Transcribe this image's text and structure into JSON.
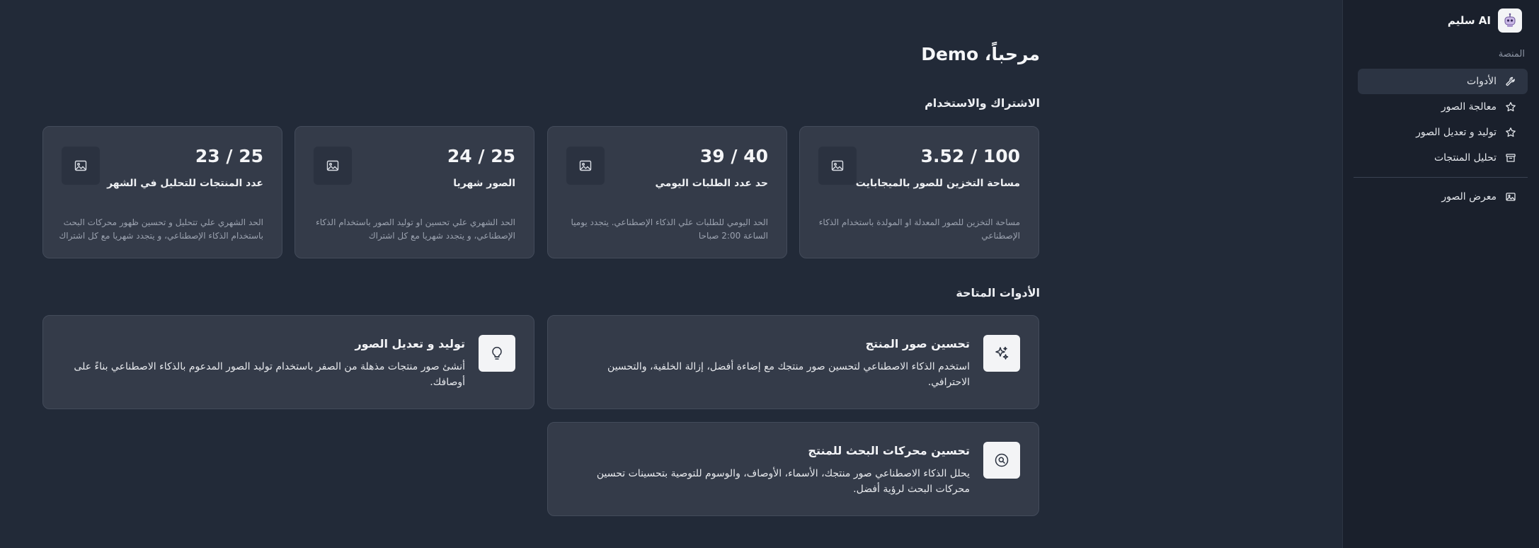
{
  "sidebar": {
    "brand_name": "سليم AI",
    "section_label": "المنصة",
    "items": [
      {
        "label": "الأدوات",
        "icon": "wrench-icon",
        "active": true
      },
      {
        "label": "معالجة الصور",
        "icon": "star-icon"
      },
      {
        "label": "توليد و تعديل الصور",
        "icon": "star-icon"
      },
      {
        "label": "تحليل المنتجات",
        "icon": "archive-icon"
      }
    ],
    "gallery": {
      "label": "معرض الصور",
      "icon": "image-icon"
    }
  },
  "main": {
    "welcome": "مرحباً، Demo",
    "usage_heading": "الاشتراك والاستخدام",
    "stats": [
      {
        "value": "3.52 / 100",
        "title": "مساحة التخزين للصور بالميجابايت",
        "desc": "مساحة التخزين للصور المعدلة او المولدة باستخدام الذكاء الإصطناعي"
      },
      {
        "value": "39 / 40",
        "title": "حد عدد الطلبات اليومي",
        "desc": "الحد اليومي للطلبات علي الذكاء الإصطناعي. يتجدد يوميا الساعة 2:00 صباحا"
      },
      {
        "value": "24 / 25",
        "title": "الصور شهريا",
        "desc": "الحد الشهري علي تحسين او توليد الصور باستخدام الذكاء الإصطناعي، و يتجدد شهريا مع كل اشتراك"
      },
      {
        "value": "23 / 25",
        "title": "عدد المنتجات للتحليل في الشهر",
        "desc": "الحد الشهري علي تتحليل و تحسين ظهور محركات البحث باستخدام الذكاء الإصطناعي، و يتجدد شهريا مع كل اشتراك"
      }
    ],
    "tools_heading": "الأدوات المتاحة",
    "tools": [
      {
        "title": "تحسين صور المنتج",
        "desc": "استخدم الذكاء الاصطناعي لتحسين صور منتجك مع إضاءة أفضل، إزالة الخلفية، والتحسين الاحترافي.",
        "icon": "sparkles-icon"
      },
      {
        "title": "توليد و تعديل الصور",
        "desc": "أنشئ صور منتجات مذهلة من الصفر باستخدام توليد الصور المدعوم بالذكاء الاصطناعي بناءً على أوصافك.",
        "icon": "lightbulb-icon"
      },
      {
        "title": "تحسين محركات البحث للمنتج",
        "desc": "يحلل الذكاء الاصطناعي صور منتجك، الأسماء، الأوصاف، والوسوم للتوصية بتحسينات تحسين محركات البحث لرؤية أفضل.",
        "icon": "search-icon"
      }
    ]
  }
}
